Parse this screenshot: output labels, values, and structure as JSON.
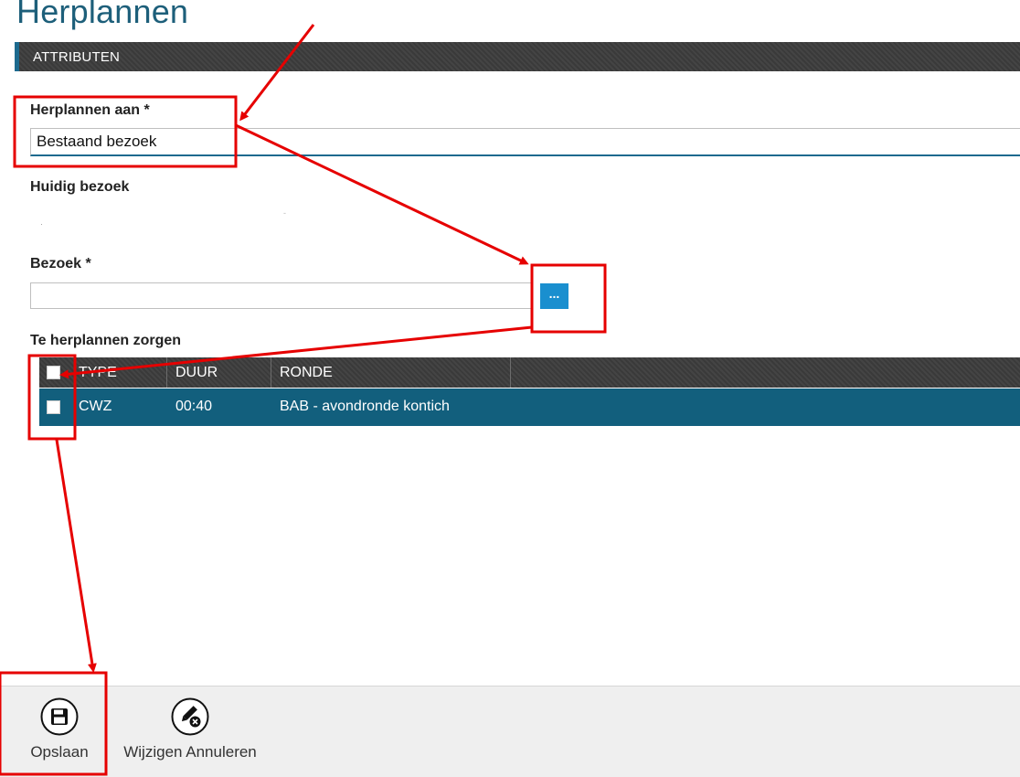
{
  "page": {
    "title": "Herplannen"
  },
  "section": {
    "label": "ATTRIBUTEN"
  },
  "form": {
    "herplannen_label": "Herplannen aan *",
    "herplannen_value": "Bestaand bezoek",
    "huidig_label": "Huidig bezoek",
    "bezoek_label": "Bezoek *",
    "bezoek_value": "",
    "lookup_label": "...",
    "zorgen_label": "Te herplannen zorgen"
  },
  "grid": {
    "columns": [
      "TYPE",
      "DUUR",
      "RONDE"
    ],
    "rows": [
      {
        "type": "CWZ",
        "duur": "00:40",
        "ronde": "BAB - avondronde kontich",
        "checked": false
      }
    ],
    "header_checked": false
  },
  "toolbar": {
    "save_label": "Opslaan",
    "cancel_label": "Wijzigen Annuleren"
  },
  "colors": {
    "accent": "#1d6a8e",
    "row_selected": "#125f7d",
    "lookup_button": "#1a8fcf",
    "annotation": "#e60000"
  },
  "icons": {
    "save": "floppy-disk-icon",
    "cancel": "edit-cancel-icon"
  }
}
